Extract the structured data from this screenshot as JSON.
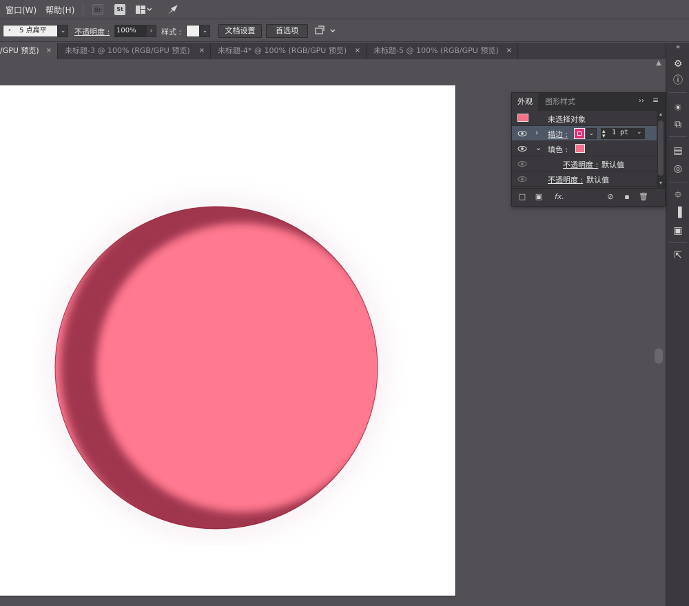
{
  "menu": {
    "window_label": "窗口(W)",
    "help_label": "帮助(H)",
    "bridge_icon": "Br",
    "stock_icon": "St",
    "layout_icon": "workspace-layout-icon",
    "gpu_icon": "gpu-rocket-icon"
  },
  "control_bar": {
    "brush_value": "5 点扁平",
    "opacity_label": "不透明度 :",
    "opacity_value": "100%",
    "style_label": "样式 :",
    "doc_settings_label": "文档设置",
    "preferences_label": "首选项"
  },
  "tabs": [
    {
      "label": "/GPU 预览)",
      "active": true
    },
    {
      "label": "未标题-3 @ 100% (RGB/GPU 预览)",
      "active": false
    },
    {
      "label": "未标题-4* @ 100% (RGB/GPU 预览)",
      "active": false
    },
    {
      "label": "未标题-5 @ 100% (RGB/GPU 预览)",
      "active": false
    }
  ],
  "tab_close_glyph": "×",
  "appearance_panel": {
    "tab_appearance": "外观",
    "tab_graphic_styles": "图形样式",
    "no_selection": "未选择对象",
    "stroke_label": "描边 :",
    "stroke_weight": "1 pt",
    "fill_label": "填色 :",
    "fill_opacity_label": "不透明度 :",
    "fill_opacity_value": "默认值",
    "object_opacity_label": "不透明度 :",
    "object_opacity_value": "默认值",
    "fx_label": "fx."
  },
  "colors": {
    "circle_fill": "#ff7a90",
    "circle_stroke": "#b0334a",
    "stroke_swatch": "#e0307a",
    "fill_swatch": "#f4738a",
    "selection_swatch": "#f4738a"
  }
}
